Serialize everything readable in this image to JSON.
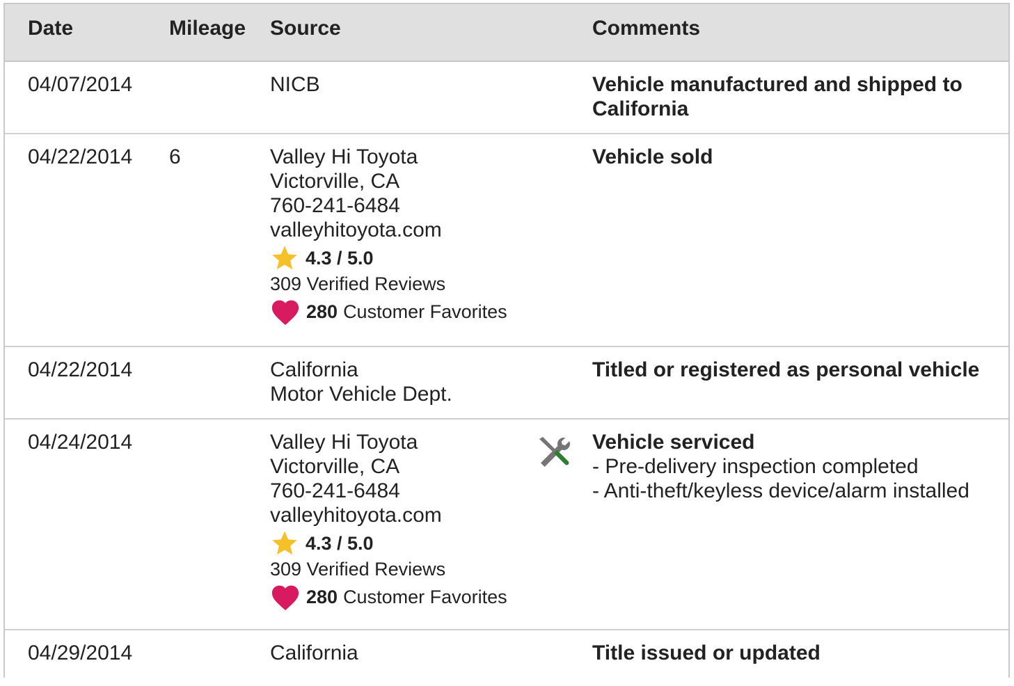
{
  "columns": {
    "date": "Date",
    "mileage": "Mileage",
    "source": "Source",
    "comments": "Comments"
  },
  "rows": [
    {
      "date": "04/07/2014",
      "mileage": "",
      "source": [
        "NICB"
      ],
      "comment_title": "Vehicle manufactured and shipped to California"
    },
    {
      "date": "04/22/2014",
      "mileage": "6",
      "source": [
        "Valley Hi Toyota",
        "Victorville, CA",
        "760-241-6484",
        "valleyhitoyota.com"
      ],
      "rating": "4.3 / 5.0",
      "reviews": "309 Verified Reviews",
      "favorites_count": "280",
      "favorites_label": "Customer Favorites",
      "comment_title": "Vehicle sold"
    },
    {
      "date": "04/22/2014",
      "mileage": "",
      "source": [
        "California",
        "Motor Vehicle Dept."
      ],
      "comment_title": "Titled or registered as personal vehicle"
    },
    {
      "date": "04/24/2014",
      "mileage": "",
      "source": [
        "Valley Hi Toyota",
        "Victorville, CA",
        "760-241-6484",
        "valleyhitoyota.com"
      ],
      "rating": "4.3 / 5.0",
      "reviews": "309 Verified Reviews",
      "favorites_count": "280",
      "favorites_label": "Customer Favorites",
      "icon": "service-tools-icon",
      "comment_title": "Vehicle serviced",
      "comment_items": [
        "Pre-delivery inspection completed",
        "Anti-theft/keyless device/alarm installed"
      ]
    },
    {
      "date": "04/29/2014",
      "mileage": "",
      "source": [
        "California"
      ],
      "comment_title": "Title issued or updated"
    }
  ],
  "colors": {
    "header_bg": "#e0e0e0",
    "star": "#f5c02a",
    "heart": "#d81b60",
    "tool_green": "#2e7d32",
    "tool_gray": "#757575"
  }
}
